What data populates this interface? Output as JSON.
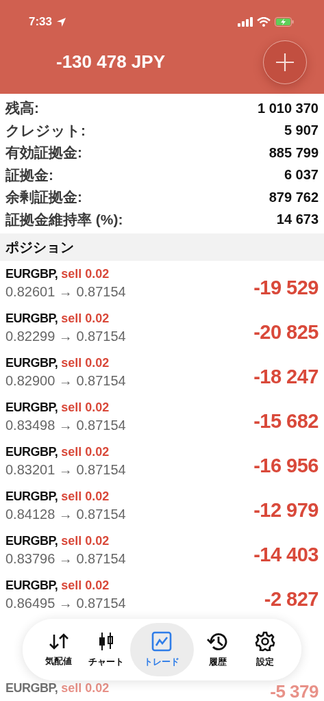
{
  "status_bar": {
    "time": "7:33"
  },
  "header": {
    "balance": "-130 478 JPY"
  },
  "summary": [
    {
      "label": "残高:",
      "value": "1 010 370"
    },
    {
      "label": "クレジット:",
      "value": "5 907"
    },
    {
      "label": "有効証拠金:",
      "value": "885 799"
    },
    {
      "label": "証拠金:",
      "value": "6 037"
    },
    {
      "label": "余剰証拠金:",
      "value": "879 762"
    },
    {
      "label": "証拠金維持率 (%):",
      "value": "14 673"
    }
  ],
  "section_title": "ポジション",
  "positions": [
    {
      "symbol": "EURGBP,",
      "side": "sell 0.02",
      "prices": "0.82601 → 0.87154",
      "pnl": "-19 529",
      "faded": false
    },
    {
      "symbol": "EURGBP,",
      "side": "sell 0.02",
      "prices": "0.82299 → 0.87154",
      "pnl": "-20 825",
      "faded": false
    },
    {
      "symbol": "EURGBP,",
      "side": "sell 0.02",
      "prices": "0.82900 → 0.87154",
      "pnl": "-18 247",
      "faded": false
    },
    {
      "symbol": "EURGBP,",
      "side": "sell 0.02",
      "prices": "0.83498 → 0.87154",
      "pnl": "-15 682",
      "faded": false
    },
    {
      "symbol": "EURGBP,",
      "side": "sell 0.02",
      "prices": "0.83201 → 0.87154",
      "pnl": "-16 956",
      "faded": false
    },
    {
      "symbol": "EURGBP,",
      "side": "sell 0.02",
      "prices": "0.84128 → 0.87154",
      "pnl": "-12 979",
      "faded": false
    },
    {
      "symbol": "EURGBP,",
      "side": "sell 0.02",
      "prices": "0.83796 → 0.87154",
      "pnl": "-14 403",
      "faded": false
    },
    {
      "symbol": "EURGBP,",
      "side": "sell 0.02",
      "prices": "0.86495 → 0.87154",
      "pnl": "-2 827",
      "faded": false
    },
    {
      "symbol": "EURGBP,",
      "side": "sell 0.02",
      "pnl": "-5 379",
      "faded": true
    }
  ],
  "nav": [
    {
      "label": "気配値",
      "kind": "quotes",
      "selected": false
    },
    {
      "label": "チャート",
      "kind": "chart",
      "selected": false
    },
    {
      "label": "トレード",
      "kind": "trade",
      "selected": true
    },
    {
      "label": "履歴",
      "kind": "history",
      "selected": false
    },
    {
      "label": "設定",
      "kind": "settings",
      "selected": false
    }
  ]
}
